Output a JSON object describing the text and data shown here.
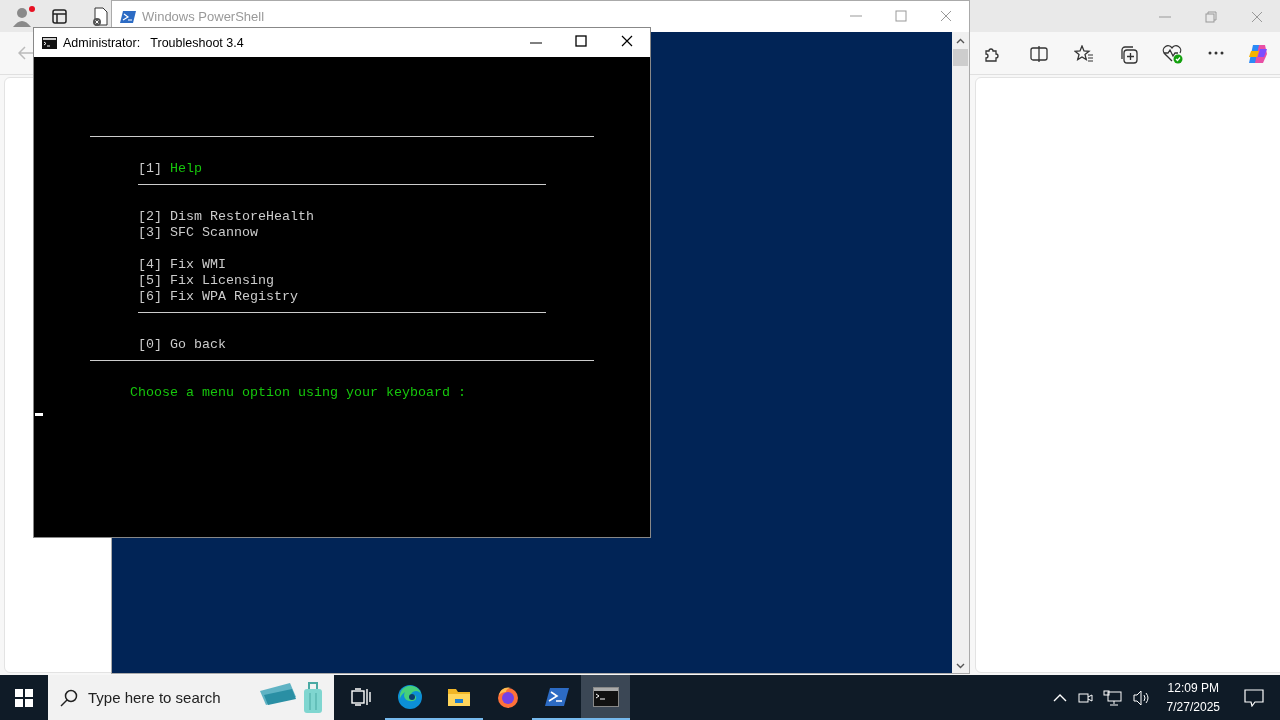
{
  "powershell_window": {
    "title": "Windows PowerShell"
  },
  "console_window": {
    "title_prefix": "Administrator:",
    "title": "Troubleshoot 3.4",
    "lines": [
      {
        "kind": "rule_wide"
      },
      {
        "kind": "blank"
      },
      {
        "kind": "option",
        "key": "[1]",
        "label": "Help",
        "highlighted": true
      },
      {
        "kind": "rule"
      },
      {
        "kind": "blank"
      },
      {
        "kind": "option",
        "key": "[2]",
        "label": "Dism RestoreHealth",
        "highlighted": false
      },
      {
        "kind": "option",
        "key": "[3]",
        "label": "SFC Scannow",
        "highlighted": false
      },
      {
        "kind": "blank"
      },
      {
        "kind": "option",
        "key": "[4]",
        "label": "Fix WMI",
        "highlighted": false
      },
      {
        "kind": "option",
        "key": "[5]",
        "label": "Fix Licensing",
        "highlighted": false
      },
      {
        "kind": "option",
        "key": "[6]",
        "label": "Fix WPA Registry",
        "highlighted": false
      },
      {
        "kind": "rule"
      },
      {
        "kind": "blank"
      },
      {
        "kind": "option",
        "key": "[0]",
        "label": "Go back",
        "highlighted": false
      },
      {
        "kind": "rule_wide"
      },
      {
        "kind": "blank"
      },
      {
        "kind": "prompt",
        "text": "Choose a menu option using your keyboard :"
      },
      {
        "kind": "cursor"
      }
    ]
  },
  "taskbar": {
    "search_placeholder": "Type here to search",
    "apps": [
      {
        "kind": "task-view",
        "running": false,
        "selected": false
      },
      {
        "kind": "edge",
        "running": true,
        "selected": false
      },
      {
        "kind": "explorer",
        "running": true,
        "selected": false
      },
      {
        "kind": "firefox",
        "running": false,
        "selected": false
      },
      {
        "kind": "powershell",
        "running": true,
        "selected": false
      },
      {
        "kind": "console",
        "running": true,
        "selected": true
      }
    ],
    "time": "12:09 PM",
    "date": "7/27/2025"
  }
}
